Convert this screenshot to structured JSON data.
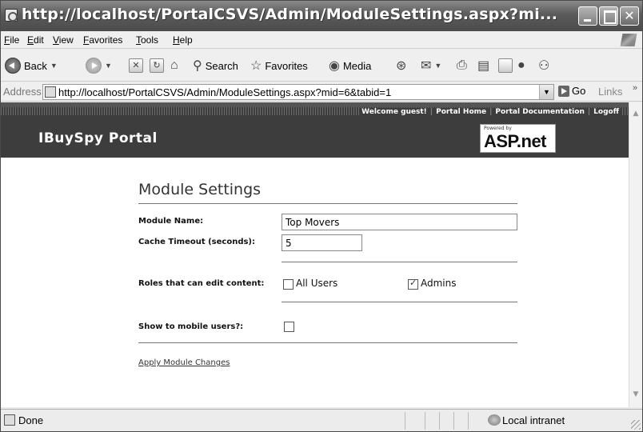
{
  "window": {
    "title": "http://localhost/PortalCSVS/Admin/ModuleSettings.aspx?mi..."
  },
  "menu": {
    "items": [
      "File",
      "Edit",
      "View",
      "Favorites",
      "Tools",
      "Help"
    ]
  },
  "toolbar": {
    "back_label": "Back",
    "search_label": "Search",
    "favorites_label": "Favorites",
    "media_label": "Media"
  },
  "address": {
    "label": "Address",
    "url": "http://localhost/PortalCSVS/Admin/ModuleSettings.aspx?mid=6&tabid=1",
    "go_label": "Go",
    "links_label": "Links"
  },
  "portal": {
    "title": "IBuySpy Portal",
    "nav": [
      "Welcome guest!",
      "Portal Home",
      "Portal Documentation",
      "Logoff"
    ],
    "logo_powered": "Powered by",
    "logo_text": "ASP.net"
  },
  "settings": {
    "heading": "Module Settings",
    "module_name_label": "Module Name:",
    "module_name_value": "Top Movers",
    "cache_label": "Cache Timeout (seconds):",
    "cache_value": "5",
    "roles_label": "Roles that can edit content:",
    "roles": [
      {
        "label": "All Users",
        "checked": false
      },
      {
        "label": "Admins",
        "checked": true
      }
    ],
    "mobile_label": "Show to mobile users?:",
    "mobile_checked": false,
    "apply_link": "Apply Module Changes"
  },
  "status": {
    "text": "Done",
    "zone": "Local intranet"
  }
}
